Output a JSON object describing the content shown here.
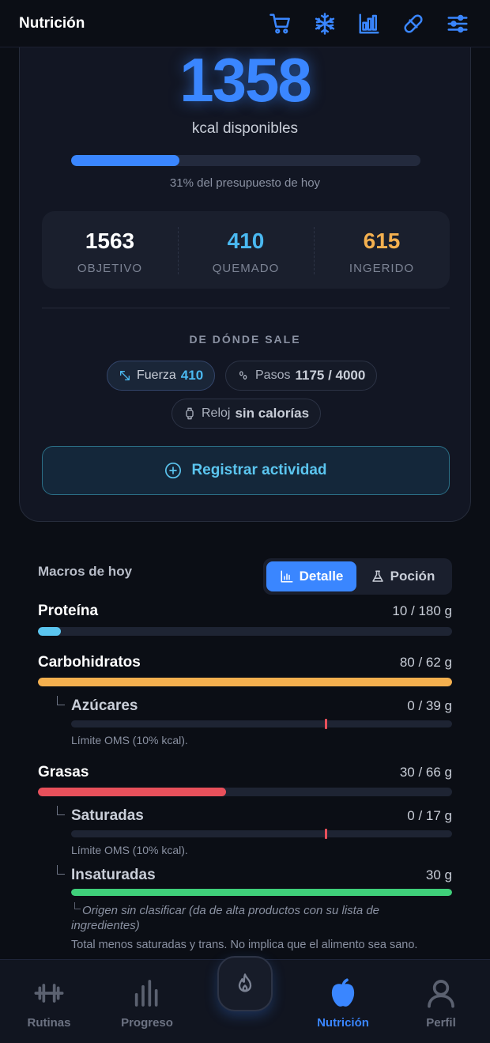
{
  "header": {
    "title": "Nutrición",
    "icons": [
      "cart-icon",
      "snowflake-icon",
      "bar-chart-icon",
      "pill-icon",
      "sliders-icon"
    ]
  },
  "summary": {
    "available_kcal": "1358",
    "available_label": "kcal disponibles",
    "budget_progress": 0.31,
    "budget_text": "31% del presupuesto de hoy",
    "stats": [
      {
        "value": "1563",
        "label": "OBJETIVO"
      },
      {
        "value": "410",
        "label": "QUEMADO"
      },
      {
        "value": "615",
        "label": "INGERIDO"
      }
    ],
    "source_title": "DE DÓNDE SALE",
    "chips": {
      "fuerza": {
        "label": "Fuerza",
        "value": "410"
      },
      "pasos": {
        "label": "Pasos",
        "value": "1175 / 4000"
      },
      "reloj": {
        "label": "Reloj",
        "value": "sin calorías"
      }
    },
    "register_button": "Registrar actividad"
  },
  "macros": {
    "title": "Macros de hoy",
    "toggle": {
      "detalle": "Detalle",
      "pocion": "Poción",
      "active": "detalle"
    },
    "items": {
      "proteina": {
        "name": "Proteína",
        "value": "10 / 180 g",
        "fraction": 0.056,
        "color": "#5bc5ef"
      },
      "carbohidratos": {
        "name": "Carbohidratos",
        "value": "80 / 62 g",
        "fraction": 1.0,
        "color": "#f4b04f"
      },
      "azucares": {
        "name": "Azúcares",
        "value": "0 / 39 g",
        "fraction": 0.0,
        "note": "Límite OMS (10% kcal)."
      },
      "grasas": {
        "name": "Grasas",
        "value": "30 / 66 g",
        "fraction": 0.455,
        "color": "#e8505b"
      },
      "saturadas": {
        "name": "Saturadas",
        "value": "0 / 17 g",
        "fraction": 0.0,
        "note": "Límite OMS (10% kcal)."
      },
      "insaturadas": {
        "name": "Insaturadas",
        "value": "30 g",
        "fraction": 1.0,
        "color": "#3fcf7a",
        "origin_note": "Origen sin clasificar (da de alta productos con su lista de ingredientes)",
        "note": "Total menos saturadas y trans. No implica que el alimento sea sano."
      }
    }
  },
  "nav": {
    "rutinas": "Rutinas",
    "progreso": "Progreso",
    "nutricion": "Nutrición",
    "perfil": "Perfil",
    "active": "nutricion"
  }
}
